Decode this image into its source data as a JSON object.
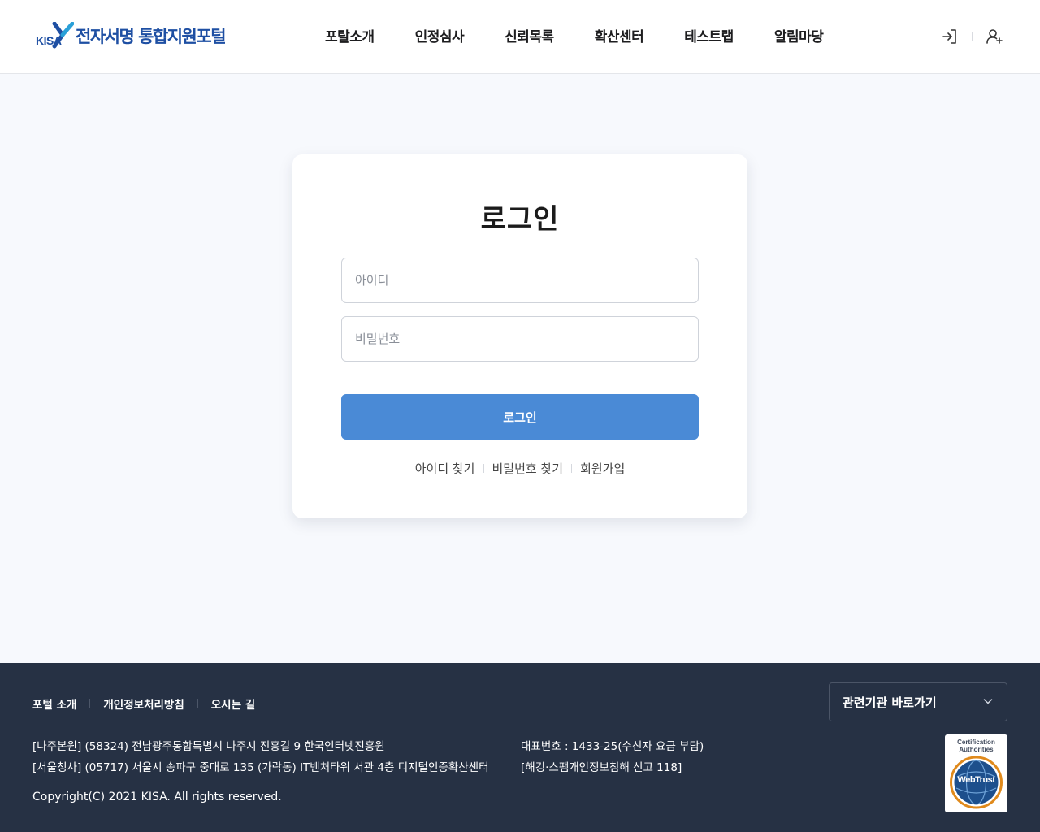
{
  "header": {
    "logo_abbr": "KISA",
    "logo_title": "전자서명 통합지원포털",
    "nav": [
      "포탈소개",
      "인정심사",
      "신뢰목록",
      "확산센터",
      "테스트랩",
      "알림마당"
    ],
    "icons": [
      "login-icon",
      "user-add-icon"
    ]
  },
  "login": {
    "title": "로그인",
    "id_placeholder": "아이디",
    "pw_placeholder": "비밀번호",
    "button_label": "로그인",
    "links": [
      "아이디 찾기",
      "비밀번호 찾기",
      "회원가입"
    ]
  },
  "footer": {
    "links": [
      "포털 소개",
      "개인정보처리방침",
      "오시는 길"
    ],
    "related_select": "관련기관 바로가기",
    "address_1": "[나주본원] (58324) 전남광주통합특별시 나주시 진흥길 9 한국인터넷진흥원",
    "address_2": "[서울청사] (05717) 서울시 송파구 중대로 135 (가락동) IT벤처타워 서관 4층 디지털인증확산센터",
    "contact_1": "대표번호 : 1433-25(수신자 요금 부담)",
    "contact_2": "[해킹·스팸개인정보침해 신고 118]",
    "copyright": "Copyright(C) 2021 KISA. All rights reserved.",
    "badge_top": "Certification Authorities",
    "badge_name": "WebTrust"
  },
  "colors": {
    "brand_blue": "#1e4fa3",
    "button_blue": "#4a8ad6",
    "footer_bg": "#263144",
    "page_bg": "#f7f9fd"
  }
}
